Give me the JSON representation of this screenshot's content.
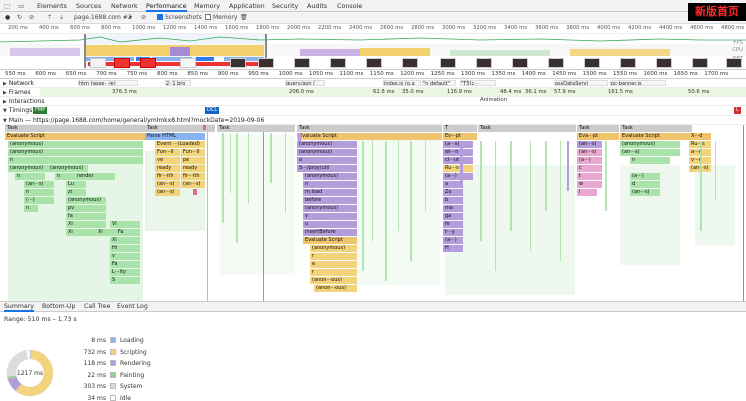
{
  "devtools_tabs": [
    "Elements",
    "Sources",
    "Network",
    "Performance",
    "Memory",
    "Application",
    "Security",
    "Audits",
    "Console"
  ],
  "toolbar": {
    "profile": "page.1688.com #2",
    "screenshots": "Screenshots",
    "memory": "Memory"
  },
  "overlay_badge": "新版首页",
  "overview_ticks": [
    "200 ms",
    "400 ms",
    "600 ms",
    "800 ms",
    "1000 ms",
    "1200 ms",
    "1400 ms",
    "1600 ms",
    "1800 ms",
    "2000 ms",
    "2200 ms",
    "2400 ms",
    "2600 ms",
    "2800 ms",
    "3000 ms",
    "3200 ms",
    "3400 ms",
    "3600 ms",
    "3800 ms",
    "4000 ms",
    "4200 ms",
    "4400 ms",
    "4600 ms",
    "4800 ms"
  ],
  "overview_labels": {
    "fps": "FPS",
    "cpu": "CPU",
    "net": "NET"
  },
  "ruler_ticks": [
    "550 ms",
    "600 ms",
    "650 ms",
    "700 ms",
    "750 ms",
    "800 ms",
    "850 ms",
    "900 ms",
    "950 ms",
    "1000 ms",
    "1050 ms",
    "1100 ms",
    "1150 ms",
    "1200 ms",
    "1250 ms",
    "1300 ms",
    "1350 ms",
    "1400 ms",
    "1450 ms",
    "1500 ms",
    "1550 ms",
    "1600 ms",
    "1650 ms",
    "1700 ms"
  ],
  "tracks": {
    "network": "Network",
    "frames": "Frames",
    "interactions": "Interactions",
    "timings": "Timings",
    "main": "Main — https://page.1688.com/home/general/ymlmkx8.html?mockDate=2019-09-06"
  },
  "network_requests": [
    "htm (spee···le)",
    "2··1 bro",
    "query.json (",
    "index.js (g.a",
    "\"n default\"",
    "\"T5(c···",
    "ossDataServi",
    "pc-banner.js"
  ],
  "frames": [
    "376.3 ms",
    "206.0 ms",
    "62.8 ms",
    "35.0 ms",
    "116.9 ms",
    "48.4 ms",
    "36.1 ms",
    "57.9 ms",
    "161.5 ms",
    "50.6 ms"
  ],
  "frames_sub": "Animation",
  "timings": {
    "fmp": "FMP",
    "dcl": "DCL",
    "l": "L"
  },
  "flame_rows": [
    [
      "Task",
      "Task",
      "Task",
      "Task",
      "T",
      "Task",
      "Task",
      "Task"
    ],
    [
      "Evaluate Script",
      "Parse HTML",
      "Evaluate Script",
      "Ev···pt",
      "Eva···pt",
      "Evaluate Script",
      "X···d"
    ],
    [
      "(anonymous)",
      "Event ···(Loaded)",
      "(anonymous)",
      "(a···s)",
      "(an···s)",
      "(anonymous)",
      "Ru···s"
    ],
    [
      "(anonymous)",
      "Fun···ll",
      "Fun···ll",
      "(anonymous)",
      "wi···n",
      "(an···s)",
      "(an···s)",
      "a···e"
    ],
    [
      "n",
      "ve",
      "pe",
      "a",
      "cl···ut",
      "(a···)",
      "n",
      "v···e"
    ],
    [
      "(anonymous)",
      "(anonymous)",
      "ready",
      "ready",
      "S···/proy/util",
      "Ru···s",
      "c",
      "(an···s)"
    ],
    [
      "n",
      "n",
      "render",
      "fir···ith",
      "fir···ith",
      "(anonymous)",
      "(a···)",
      "t",
      "(a···)"
    ],
    [
      "(an···s)",
      "Lu",
      "(an···s)",
      "(an···s)",
      "n",
      "a",
      "w",
      "d"
    ],
    [
      "n",
      "zi",
      "(an···s)",
      "m.load",
      "Zo",
      "i",
      "(an···s)"
    ],
    [
      "(···)",
      "(anonymous)",
      "before",
      "b"
    ],
    [
      "n",
      "pv",
      "(anonymous)",
      "ma"
    ],
    [
      "fa",
      "v",
      "ga"
    ],
    [
      "Xi",
      "Vi",
      "u",
      "fe"
    ],
    [
      "Xi",
      "Xi",
      "Fa",
      "insertBefore",
      "t···y"
    ],
    [
      "Xi",
      "Evaluate Script",
      "(a···)"
    ],
    [
      "Hi",
      "(anonymous)",
      "H"
    ],
    [
      "v",
      "r"
    ],
    [
      "Fa",
      "e"
    ],
    [
      "L···ity",
      "r"
    ],
    [
      "S",
      "(anon···ous)"
    ],
    [
      "(anon···ous)"
    ]
  ],
  "bottom_tabs": [
    "Summary",
    "Bottom-Up",
    "Call Tree",
    "Event Log"
  ],
  "summary": {
    "range": "Range: 510 ms – 1.73 s",
    "total": "1217 ms",
    "items": [
      {
        "value": "8 ms",
        "label": "Loading",
        "color": "#8cb0e8",
        "ms": 8
      },
      {
        "value": "732 ms",
        "label": "Scripting",
        "color": "#f3d37b",
        "ms": 732
      },
      {
        "value": "118 ms",
        "label": "Rendering",
        "color": "#b39ddb",
        "ms": 118
      },
      {
        "value": "22 ms",
        "label": "Painting",
        "color": "#8fce8f",
        "ms": 22
      },
      {
        "value": "303 ms",
        "label": "System",
        "color": "#dcdcdc",
        "ms": 303
      },
      {
        "value": "34 ms",
        "label": "Idle",
        "color": "#ffffff",
        "ms": 34
      }
    ]
  }
}
